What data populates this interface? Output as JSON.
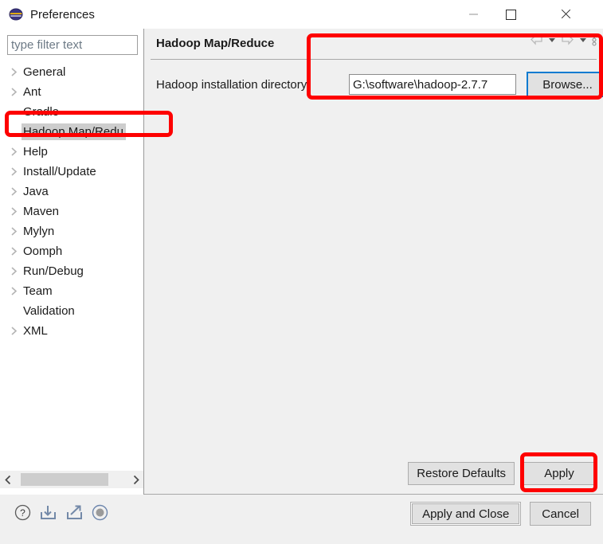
{
  "window": {
    "title": "Preferences",
    "app_icon": "eclipse-globe-icon",
    "controls": {
      "minimize": "minimize-icon",
      "maximize": "maximize-icon",
      "close": "close-icon"
    }
  },
  "sidebar": {
    "filter": {
      "value": "",
      "placeholder": "type filter text"
    },
    "items": [
      {
        "label": "General",
        "expandable": true,
        "selected": false
      },
      {
        "label": "Ant",
        "expandable": true,
        "selected": false
      },
      {
        "label": "Gradle",
        "expandable": false,
        "selected": false
      },
      {
        "label": "Hadoop Map/Redu",
        "expandable": false,
        "selected": true
      },
      {
        "label": "Help",
        "expandable": true,
        "selected": false
      },
      {
        "label": "Install/Update",
        "expandable": true,
        "selected": false
      },
      {
        "label": "Java",
        "expandable": true,
        "selected": false
      },
      {
        "label": "Maven",
        "expandable": true,
        "selected": false
      },
      {
        "label": "Mylyn",
        "expandable": true,
        "selected": false
      },
      {
        "label": "Oomph",
        "expandable": true,
        "selected": false
      },
      {
        "label": "Run/Debug",
        "expandable": true,
        "selected": false
      },
      {
        "label": "Team",
        "expandable": true,
        "selected": false
      },
      {
        "label": "Validation",
        "expandable": false,
        "selected": false
      },
      {
        "label": "XML",
        "expandable": true,
        "selected": false
      }
    ],
    "scrollbar": {
      "left_arrow": "chevron-left-icon",
      "right_arrow": "chevron-right-icon"
    }
  },
  "content": {
    "title": "Hadoop Map/Reduce",
    "nav_icons": [
      "back-arrow-icon",
      "back-dropdown-icon",
      "forward-arrow-icon",
      "forward-dropdown-icon",
      "view-menu-icon"
    ],
    "field": {
      "label": "Hadoop installation directory:",
      "value": "G:\\software\\hadoop-2.7.7",
      "placeholder": "",
      "browse_label": "Browse..."
    },
    "buttons": {
      "restore_defaults": "Restore Defaults",
      "apply": "Apply"
    }
  },
  "footer": {
    "icons": [
      "help-icon",
      "import-icon",
      "export-icon",
      "oomph-recorder-icon"
    ],
    "buttons": {
      "apply_and_close": "Apply and Close",
      "cancel": "Cancel"
    }
  },
  "annotations": {
    "color": "#FE0000",
    "boxes": [
      {
        "name": "tree-selection-highlight"
      },
      {
        "name": "directory-field-highlight"
      },
      {
        "name": "apply-button-highlight"
      }
    ]
  }
}
